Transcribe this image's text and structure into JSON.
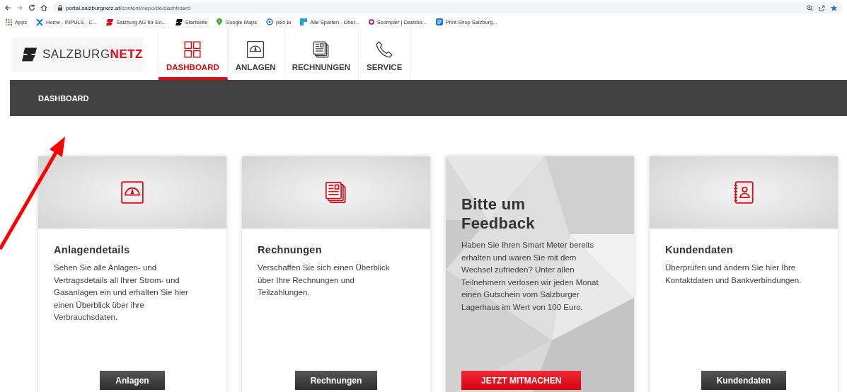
{
  "browser": {
    "url_host": "portal.salzburgnetz.at",
    "url_path": "/content/nepo/de/dashboard",
    "bookmarks": [
      {
        "label": "Apps"
      },
      {
        "label": "Home - INPULS - C..."
      },
      {
        "label": "Salzburg AG für En..."
      },
      {
        "label": "Startseite"
      },
      {
        "label": "Google Maps"
      },
      {
        "label": "pixx.io"
      },
      {
        "label": "Alle Sparten - Über..."
      },
      {
        "label": "Scompler | Dashbo..."
      },
      {
        "label": "Print Shop Salzburg..."
      }
    ]
  },
  "logo": {
    "text": "SALZBURG",
    "accent": "NETZ"
  },
  "nav": [
    {
      "label": "DASHBOARD",
      "selected": true
    },
    {
      "label": "ANLAGEN",
      "selected": false
    },
    {
      "label": "RECHNUNGEN",
      "selected": false
    },
    {
      "label": "SERVICE",
      "selected": false
    }
  ],
  "breadcrumb": "DASHBOARD",
  "cards": [
    {
      "kind": "feature",
      "title": "Anlagendetails",
      "text": "Sehen Sie alle Anlagen- und Vertragsdetails all Ihrer Strom- und Gasanlagen ein und erhalten Sie hier einen Überblick über ihre Verbrauchsdaten.",
      "button": "Anlagen"
    },
    {
      "kind": "feature",
      "title": "Rechnungen",
      "text": "Verschaffen Sie sich einen Überblick über Ihre Rechnungen und Teilzahlungen.",
      "button": "Rechnungen"
    },
    {
      "kind": "promo",
      "title": "Bitte um Feedback",
      "text": "Haben Sie Ihren Smart Meter bereits erhalten und waren Sie mit dem Wechsel zufrieden? Unter allen Teilnehmern verlosen wir jeden Monat einen Gutschein vom Salzburger Lagerhaus im Wert von 100 Euro.",
      "button": "JETZT MITMACHEN"
    },
    {
      "kind": "feature",
      "title": "Kundendaten",
      "text": "Überprüfen und ändern Sie hier Ihre Kontaktdaten und Bankverbindungen.",
      "button": "Kundendaten"
    }
  ]
}
